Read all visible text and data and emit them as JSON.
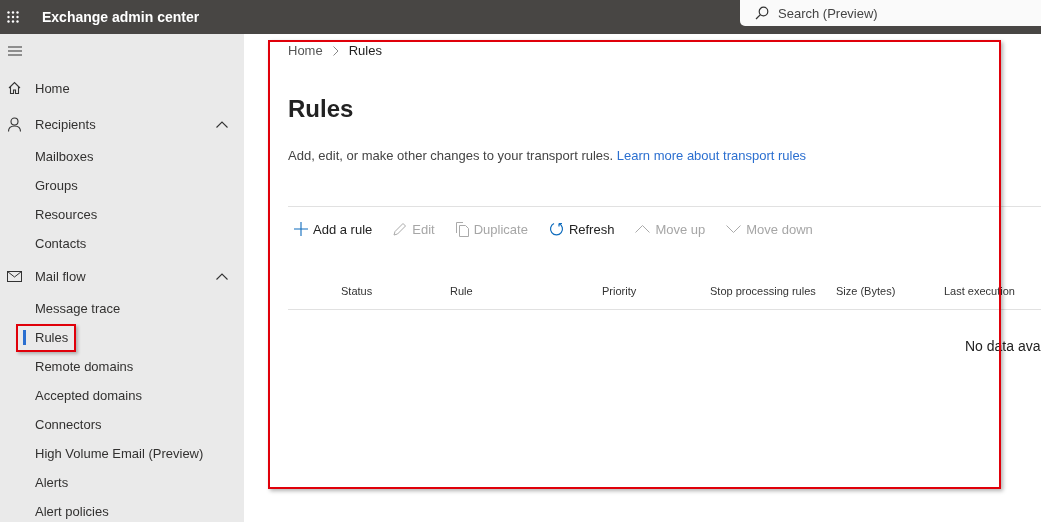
{
  "topbar": {
    "app_title": "Exchange admin center",
    "search": {
      "placeholder": "Search (Preview)"
    }
  },
  "nav": [
    {
      "label": "Home",
      "kind": "home"
    },
    {
      "label": "Recipients",
      "kind": "person",
      "expanded": true,
      "children": [
        {
          "label": "Mailboxes",
          "selected": false,
          "highlighted": false
        },
        {
          "label": "Groups",
          "selected": false,
          "highlighted": false
        },
        {
          "label": "Resources",
          "selected": false,
          "highlighted": false
        },
        {
          "label": "Contacts",
          "selected": false,
          "highlighted": false
        }
      ]
    },
    {
      "label": "Mail flow",
      "kind": "mail",
      "expanded": true,
      "children": [
        {
          "label": "Message trace",
          "selected": false,
          "highlighted": false
        },
        {
          "label": "Rules",
          "selected": true,
          "highlighted": true
        },
        {
          "label": "Remote domains",
          "selected": false,
          "highlighted": false
        },
        {
          "label": "Accepted domains",
          "selected": false,
          "highlighted": false
        },
        {
          "label": "Connectors",
          "selected": false,
          "highlighted": false
        },
        {
          "label": "High Volume Email (Preview)",
          "selected": false,
          "highlighted": false
        },
        {
          "label": "Alerts",
          "selected": false,
          "highlighted": false
        },
        {
          "label": "Alert policies",
          "selected": false,
          "highlighted": false
        }
      ]
    }
  ],
  "main": {
    "highlighted": true,
    "breadcrumb": [
      "Home",
      "Rules"
    ],
    "title": "Rules",
    "description": "Add, edit, or make other changes to your transport rules.",
    "learn_more_link": "Learn more about transport rules",
    "toolbar": [
      {
        "label": "Add a rule",
        "kind": "add",
        "disabled": false
      },
      {
        "label": "Edit",
        "kind": "edit",
        "disabled": true
      },
      {
        "label": "Duplicate",
        "kind": "duplicate",
        "disabled": true
      },
      {
        "label": "Refresh",
        "kind": "refresh",
        "disabled": false
      },
      {
        "label": "Move up",
        "kind": "up",
        "disabled": true
      },
      {
        "label": "Move down",
        "kind": "down",
        "disabled": true
      }
    ],
    "table": {
      "columns": [
        "Status",
        "Rule",
        "Priority",
        "Stop processing rules",
        "Size (Bytes)",
        "Last execution"
      ],
      "empty_message": "No data ava"
    }
  }
}
